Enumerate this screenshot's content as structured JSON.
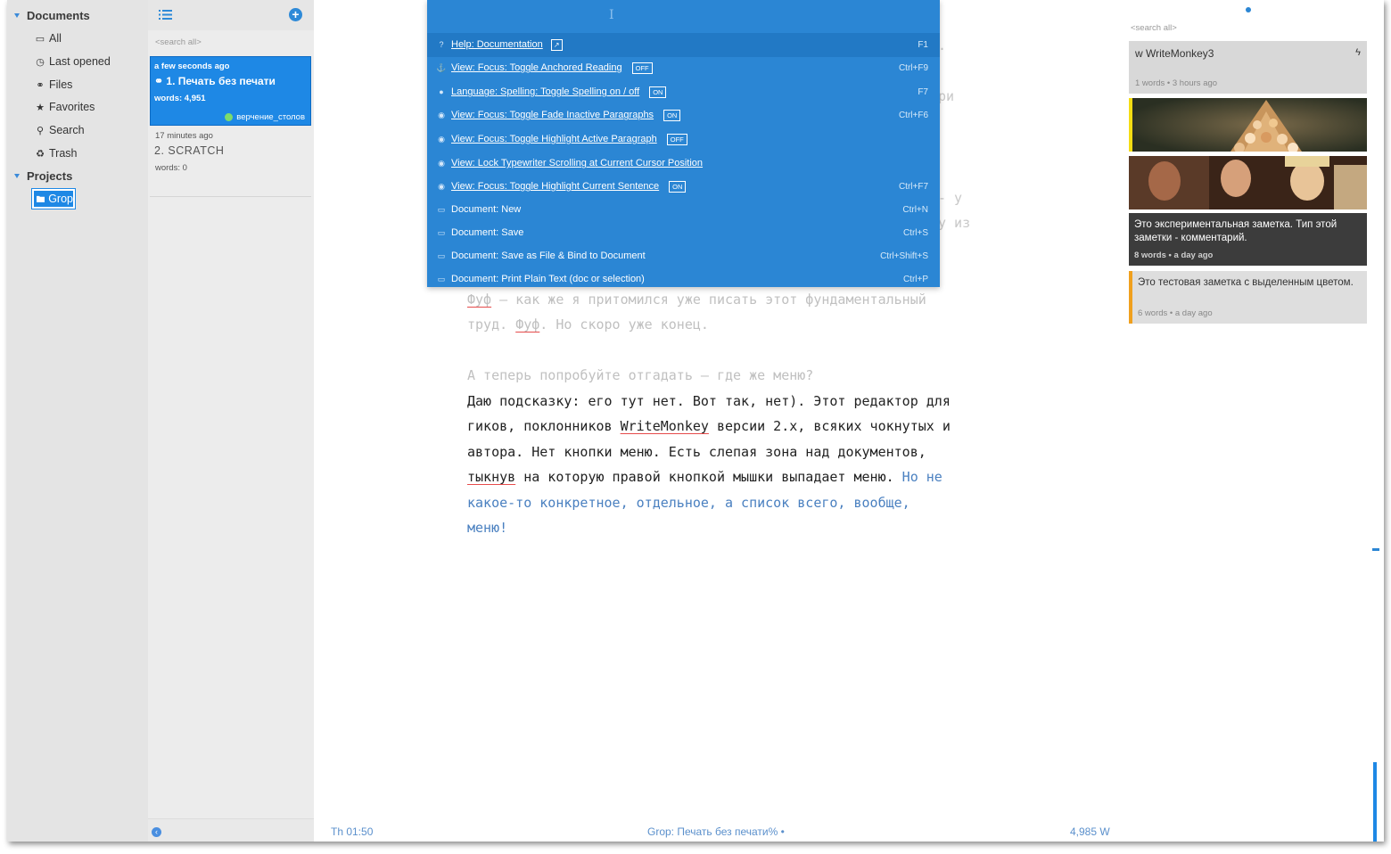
{
  "nav": {
    "documents_label": "Documents",
    "items": [
      {
        "icon": "inbox-icon",
        "glyph": "▭",
        "label": "All"
      },
      {
        "icon": "clock-icon",
        "glyph": "◷",
        "label": "Last opened"
      },
      {
        "icon": "link-icon",
        "glyph": "⚭",
        "label": "Files"
      },
      {
        "icon": "star-icon",
        "glyph": "★",
        "label": "Favorites"
      },
      {
        "icon": "search-icon",
        "glyph": "⚲",
        "label": "Search"
      },
      {
        "icon": "recycle-icon",
        "glyph": "♻",
        "label": "Trash"
      }
    ],
    "projects_label": "Projects",
    "project": "Grop"
  },
  "doclist": {
    "search_placeholder": "<search all>",
    "docs": [
      {
        "time": "a few seconds ago",
        "title": "1. Печать без печати",
        "words": "words: 4,951",
        "tag": "верчение_столов"
      },
      {
        "time": "17 minutes ago",
        "title": "2. SCRATCH",
        "words": "words: 0"
      }
    ]
  },
  "palette": {
    "commands": [
      {
        "label": "Help: Documentation",
        "link": true,
        "icon": "question-icon",
        "glyph": "?",
        "external": true,
        "key": "F1"
      },
      {
        "label": "View: Focus: Toggle Anchored Reading",
        "link": true,
        "icon": "anchor-icon",
        "glyph": "⚓",
        "badge": "OFF",
        "key": "Ctrl+F9"
      },
      {
        "label": "Language: Spelling: Toggle Spelling on / off",
        "link": true,
        "icon": "comments-icon",
        "glyph": "●",
        "badge": "ON",
        "key": "F7"
      },
      {
        "label": "View: Focus: Toggle Fade Inactive Paragraphs",
        "link": true,
        "icon": "eye-icon",
        "glyph": "◉",
        "badge": "ON",
        "key": "Ctrl+F6"
      },
      {
        "label": "View: Focus: Toggle Highlight Active Paragraph",
        "link": true,
        "icon": "eye-icon",
        "glyph": "◉",
        "badge": "OFF",
        "key": ""
      },
      {
        "label": "View: Lock Typewriter Scrolling at Current Cursor Position",
        "link": true,
        "icon": "eye-icon",
        "glyph": "◉",
        "key": ""
      },
      {
        "label": "View: Focus: Toggle Highlight Current Sentence",
        "link": true,
        "icon": "eye-icon",
        "glyph": "◉",
        "badge": "ON",
        "key": "Ctrl+F7"
      },
      {
        "label": "Document: New",
        "link": false,
        "icon": "inbox-icon",
        "glyph": "▭",
        "key": "Ctrl+N"
      },
      {
        "label": "Document: Save",
        "link": false,
        "icon": "inbox-icon",
        "glyph": "▭",
        "key": "Ctrl+S"
      },
      {
        "label": "Document: Save as File & Bind to Document",
        "link": false,
        "icon": "inbox-icon",
        "glyph": "▭",
        "key": "Ctrl+Shift+S"
      },
      {
        "label": "Document: Print Plain Text (doc or selection)",
        "link": false,
        "icon": "inbox-icon",
        "glyph": "▭",
        "key": "Ctrl+P"
      }
    ]
  },
  "editor": {
    "fragments": [
      ".",
      "ри",
      "- у",
      "у из"
    ],
    "p1_l1_a": "Фуф",
    "p1_l1_b": " – как же я притомился уже писать этот фундаментальный",
    "p1_l2_a": "труд. ",
    "p1_l2_b": "Фуф",
    "p1_l2_c": ". Но скоро уже конец.",
    "p2_l0": "А теперь попробуйте отгадать – где же меню?",
    "p2_l1": "Даю подсказку: его тут нет. Вот так, нет). Этот редактор для",
    "p2_l2_a": "гиков, поклонников ",
    "p2_l2_b": "WriteMonkey",
    "p2_l2_c": " версии 2.x, всяких чокнутых и",
    "p2_l3": "автора. Нет кнопки меню. Есть слепая зона над документов,",
    "p2_l4_a": "тыкнув",
    "p2_l4_b": " на которую правой кнопкой мышки выпадает меню. ",
    "p2_l4_c": "Но не",
    "p2_l5": "какое-то конкретное, отдельное, а список всего, вообще,",
    "p2_l6": "меню!"
  },
  "notes": {
    "search_placeholder": "<search all>",
    "items": [
      {
        "title": "w WriteMonkey3",
        "words": "1 words",
        "ago": "3 hours ago"
      },
      {
        "image": "kittens-pyramid-image"
      },
      {
        "image": "women-smoking-image"
      },
      {
        "title": "Это экспериментальная заметка. Тип этой заметки - комментарий.",
        "words": "8 words",
        "ago": "a day ago"
      },
      {
        "title": "Это тестовая заметка с выделенным цветом.",
        "words": "6 words",
        "ago": "a day ago"
      }
    ],
    "separator": "•"
  },
  "footer": {
    "time": "Th 01:50",
    "project": "Grop:",
    "doc": "Печать без печати",
    "doc_suffix": "% •",
    "words": "4,985 W"
  },
  "colors": {
    "accent": "#1e88e5",
    "palette_bg": "#2b86d4",
    "nav_bg": "#e4e4e4"
  }
}
